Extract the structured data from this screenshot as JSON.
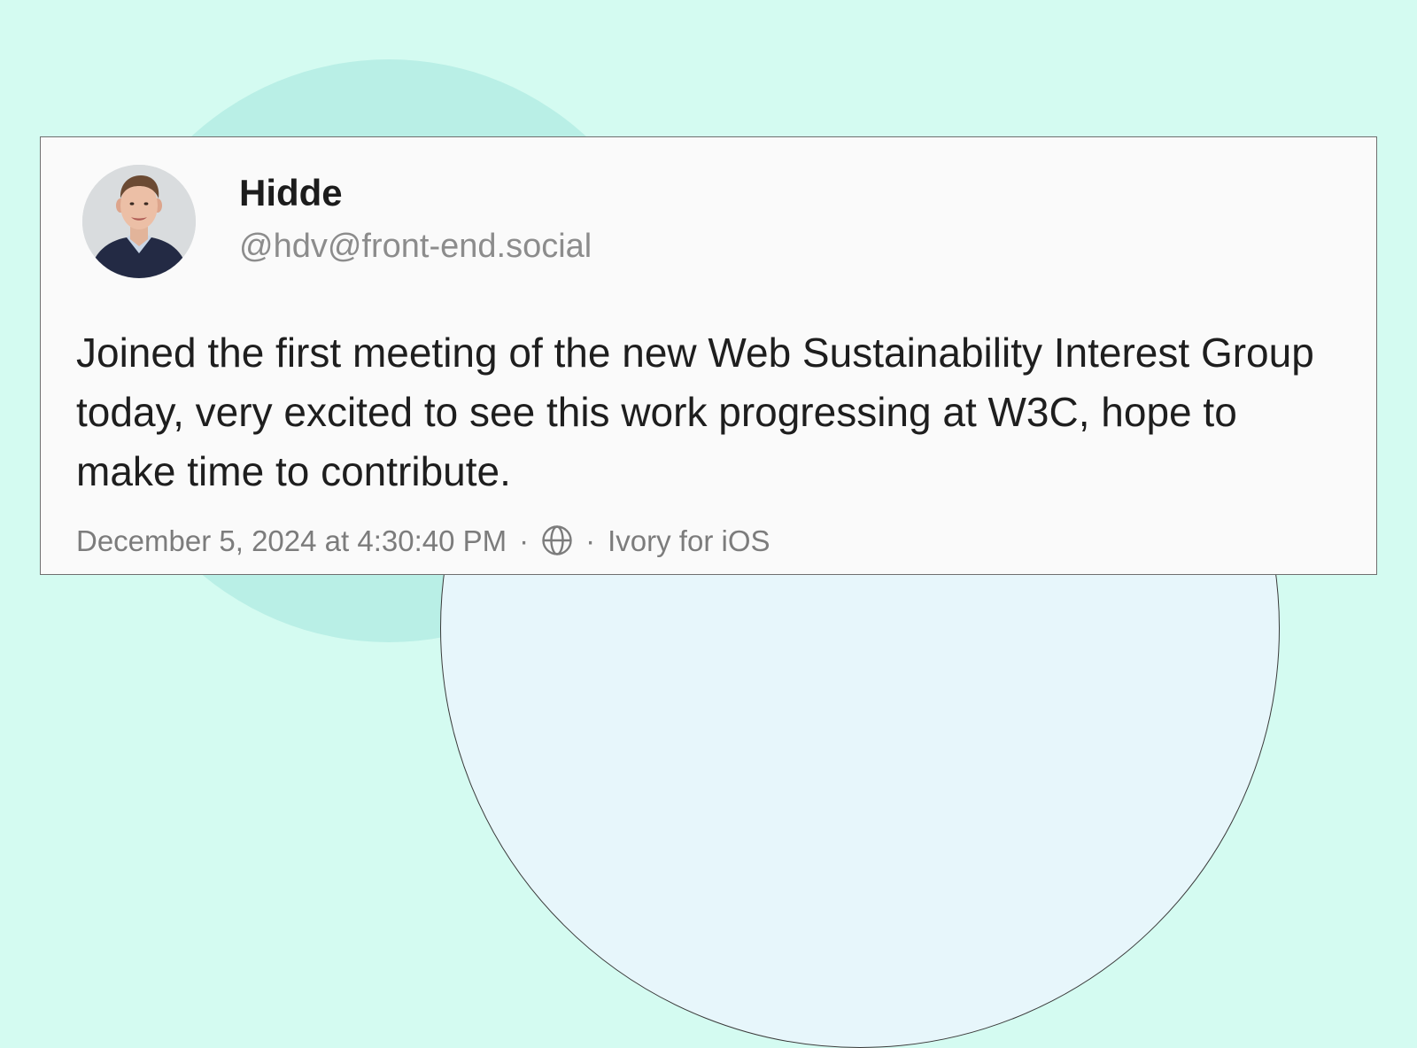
{
  "post": {
    "author": {
      "name": "Hidde",
      "handle": "@hdv@front-end.social"
    },
    "text": "Joined the first meeting of the new Web Sustainability Interest Group today, very excited to see this work progressing at W3C, hope to make time to contribute.",
    "meta": {
      "timestamp": "December 5, 2024 at 4:30:40 PM",
      "separator": "·",
      "visibility_icon": "globe-icon",
      "client": "Ivory for iOS"
    }
  },
  "colors": {
    "background": "#d4fbf1",
    "circle_teal": "#b9efe6",
    "circle_blue": "#e7f6fb",
    "card": "#fafafa",
    "text_primary": "#1e1e1e",
    "text_secondary": "#8c8c8c"
  }
}
